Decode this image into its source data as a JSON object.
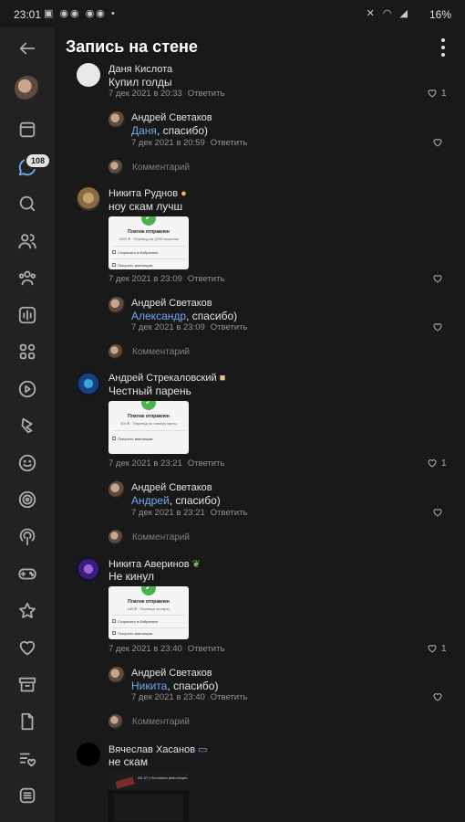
{
  "status_bar": {
    "time": "23:01",
    "battery": "16%"
  },
  "header": {
    "title": "Запись на стене"
  },
  "sidebar": {
    "messages_badge": "108"
  },
  "comment_placeholder": "Комментарий",
  "reply_label": "Ответить",
  "threads": [
    {
      "author": "Даня Кислота",
      "text": "Купил голды",
      "date": "7 дек 2021 в 20:33",
      "likes": "1",
      "reply": {
        "author": "Андрей Светаков",
        "mention": "Даня",
        "rest": ", спасибо)",
        "date": "7 дек 2021 в 20:59"
      }
    },
    {
      "author": "Никита Руднов",
      "text": "ноу скам лучш",
      "date": "7 дек 2021 в 23:09",
      "likes": "",
      "receipt": {
        "title": "Платеж отправлен",
        "sub": "2003 ₽ · Перевод на QIWI Кошелек",
        "row1": "Сохранить в Избранное",
        "row2": "Получить квитанцию"
      },
      "reply": {
        "author": "Андрей Светаков",
        "mention": "Александр",
        "rest": ", спасибо)",
        "date": "7 дек 2021 в 23:09"
      }
    },
    {
      "author": "Андрей Стрекаловский",
      "text": "Честный парень",
      "date": "7 дек 2021 в 23:21",
      "likes": "1",
      "receipt": {
        "title": "Платеж отправлен",
        "sub": "400 ₽ · Перевод по номеру карты",
        "row1": "Получить квитанцию",
        "row2": ""
      },
      "reply": {
        "author": "Андрей Светаков",
        "mention": "Андрей",
        "rest": ", спасибо)",
        "date": "7 дек 2021 в 23:21"
      }
    },
    {
      "author": "Никита Аверинов",
      "text": "Не кинул",
      "date": "7 дек 2021 в 23:40",
      "likes": "1",
      "receipt": {
        "title": "Платеж отправлен",
        "sub": "160 ₽ · Перевод на карту",
        "row1": "Сохранить в Избранное",
        "row2": "Получить квитанцию"
      },
      "reply": {
        "author": "Андрей Светаков",
        "mention": "Никита",
        "rest": ", спасибо)",
        "date": "7 дек 2021 в 23:40"
      }
    },
    {
      "author": "Вячеслав Хасанов",
      "text": "не скам",
      "screenshot": {
        "text": "AK-47 | Неоновая революция"
      }
    }
  ]
}
